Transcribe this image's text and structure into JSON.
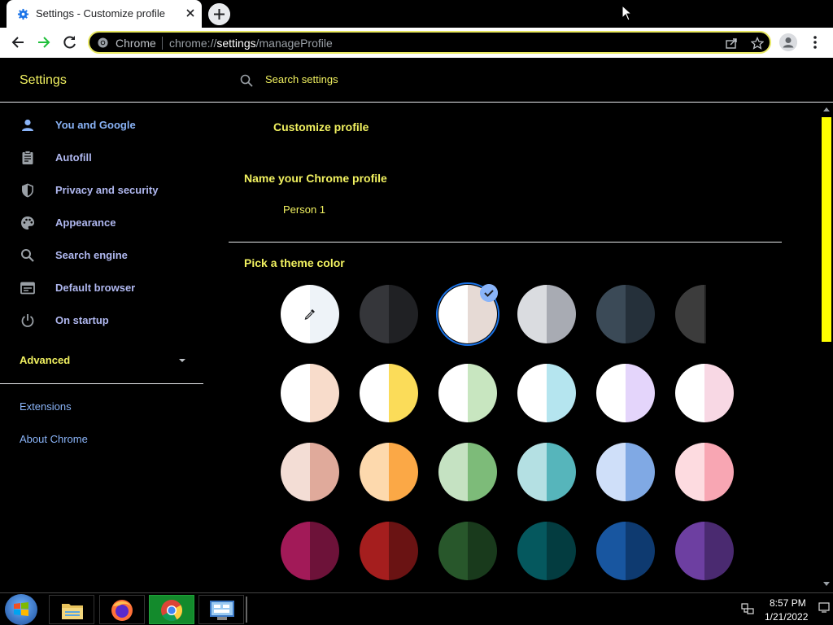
{
  "browser": {
    "tab_title": "Settings - Customize profile",
    "omnibox_chip": "Chrome",
    "url_scheme": "chrome://",
    "url_host": "settings",
    "url_path": "/manageProfile"
  },
  "settings": {
    "title": "Settings",
    "search_placeholder": "Search settings",
    "nav": [
      {
        "label": "You and Google",
        "icon": "person-icon"
      },
      {
        "label": "Autofill",
        "icon": "clipboard-icon"
      },
      {
        "label": "Privacy and security",
        "icon": "shield-icon"
      },
      {
        "label": "Appearance",
        "icon": "palette-icon"
      },
      {
        "label": "Search engine",
        "icon": "search-icon"
      },
      {
        "label": "Default browser",
        "icon": "browser-window-icon"
      },
      {
        "label": "On startup",
        "icon": "power-icon"
      }
    ],
    "advanced_label": "Advanced",
    "extensions_label": "Extensions",
    "about_label": "About Chrome"
  },
  "main": {
    "page_title": "Customize profile",
    "name_section_title": "Name your Chrome profile",
    "profile_name": "Person 1",
    "theme_section_title": "Pick a theme color",
    "selected_theme_index": 2,
    "themes": [
      {
        "left": "#ffffff",
        "right": "#eef3f8",
        "kind": "custom"
      },
      {
        "left": "#35363a",
        "right": "#202124"
      },
      {
        "left": "#ffffff",
        "right": "#e6dad5"
      },
      {
        "left": "#dadce0",
        "right": "#a8abb3"
      },
      {
        "left": "#3b4a57",
        "right": "#25303a"
      },
      {
        "left": "#3c3c3c",
        "right": "#1f1f1f",
        "partial": true
      },
      {
        "left": "#ffffff",
        "right": "#f8dccb"
      },
      {
        "left": "#ffffff",
        "right": "#fbdc59"
      },
      {
        "left": "#ffffff",
        "right": "#c8e6c0"
      },
      {
        "left": "#ffffff",
        "right": "#b5e5ef"
      },
      {
        "left": "#ffffff",
        "right": "#e4d5fb"
      },
      {
        "left": "#ffffff",
        "right": "#f8d8e4"
      },
      {
        "left": "#f3ddd5",
        "right": "#e0aa9b"
      },
      {
        "left": "#fdd9ad",
        "right": "#fba846"
      },
      {
        "left": "#c5e2c2",
        "right": "#7dbb79"
      },
      {
        "left": "#b4e0e3",
        "right": "#56b5bb"
      },
      {
        "left": "#cfdff9",
        "right": "#80a9e4"
      },
      {
        "left": "#fddbe0",
        "right": "#f8a6b3"
      },
      {
        "left": "#a21a58",
        "right": "#6d1239"
      },
      {
        "left": "#a51e1e",
        "right": "#6a1313"
      },
      {
        "left": "#28572b",
        "right": "#193a1c"
      },
      {
        "left": "#05585e",
        "right": "#033c40"
      },
      {
        "left": "#1856a0",
        "right": "#0e3a70"
      },
      {
        "left": "#6d3fa1",
        "right": "#4a2a70"
      }
    ]
  },
  "taskbar": {
    "time": "8:57 PM",
    "date": "1/21/2022",
    "items": [
      "file-explorer-icon",
      "firefox-icon",
      "chrome-icon",
      "control-panel-icon"
    ]
  },
  "colors": {
    "accent_yellow": "#f1f160",
    "nav_blue": "#8ab4f8",
    "selection_blue": "#1a73e8",
    "scroll_thumb": "#ffff00"
  }
}
